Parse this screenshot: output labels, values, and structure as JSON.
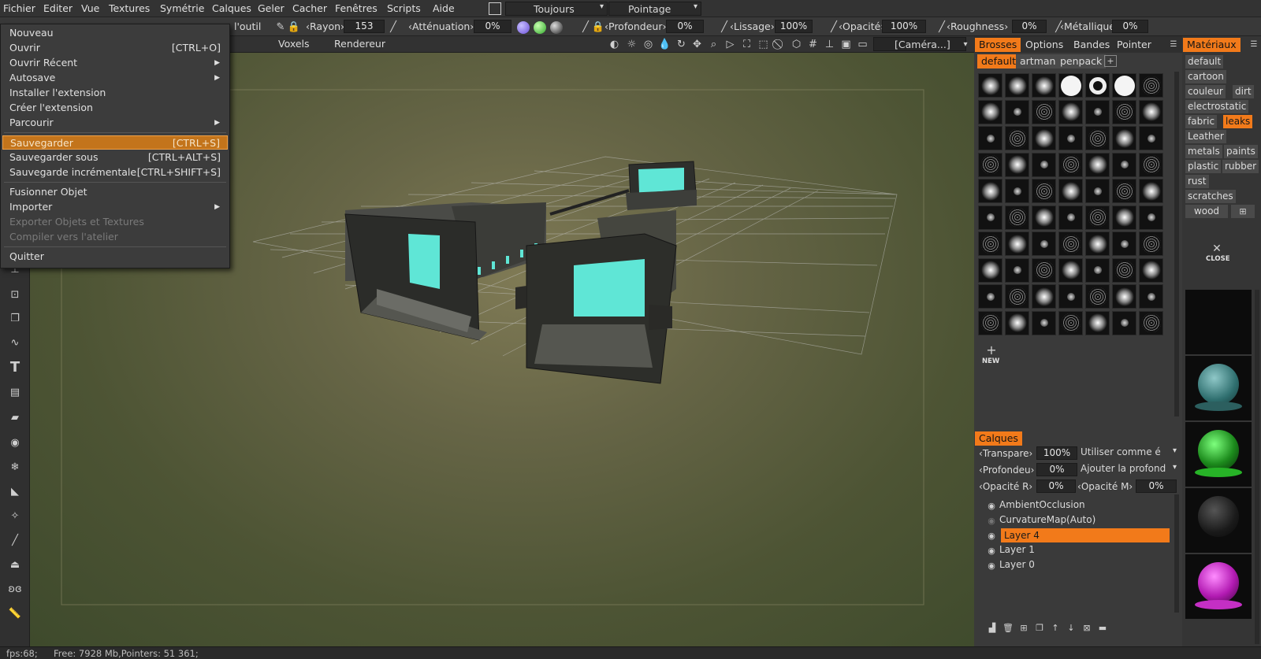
{
  "menubar": {
    "items": [
      "Fichier",
      "Editer",
      "Vue",
      "Textures",
      "Symétrie",
      "Calques",
      "Geler",
      "Cacher",
      "Fenêtres",
      "Scripts",
      "Aide"
    ],
    "mode_select": "Toujours",
    "pointer_select": "Pointage"
  },
  "toolbar": {
    "tool_label": "l'outil",
    "rayon_label": "Rayon",
    "rayon_value": "153",
    "attenuation_label": "Atténuation",
    "attenuation_value": "0%",
    "profondeur_label": "Profondeur",
    "profondeur_value": "0%",
    "lissage_label": "Lissage",
    "lissage_value": "100%",
    "opacite_label": "Opacité",
    "opacite_value": "100%",
    "roughness_label": "Roughness",
    "roughness_value": "0%",
    "metallique_label": "Métallique",
    "metallique_value": "0%"
  },
  "subbar": {
    "voxels_label": "Voxels",
    "renderer_label": "Rendereur",
    "camera_select": "[Caméra...]"
  },
  "file_menu": {
    "items": [
      {
        "label": "Nouveau",
        "shortcut": "",
        "arrow": false,
        "disabled": false
      },
      {
        "label": "Ouvrir",
        "shortcut": "[CTRL+O]",
        "arrow": false,
        "disabled": false
      },
      {
        "label": "Ouvrir Récent",
        "shortcut": "",
        "arrow": true,
        "disabled": false
      },
      {
        "label": "Autosave",
        "shortcut": "",
        "arrow": true,
        "disabled": false
      },
      {
        "label": "Installer l'extension",
        "shortcut": "",
        "arrow": false,
        "disabled": false
      },
      {
        "label": "Créer l'extension",
        "shortcut": "",
        "arrow": false,
        "disabled": false
      },
      {
        "label": "Parcourir",
        "shortcut": "",
        "arrow": true,
        "disabled": false
      },
      {
        "label": "Sauvegarder",
        "shortcut": "[CTRL+S]",
        "arrow": false,
        "disabled": false,
        "selected": true
      },
      {
        "label": "Sauvegarder sous",
        "shortcut": "[CTRL+ALT+S]",
        "arrow": false,
        "disabled": false
      },
      {
        "label": "Sauvegarde incrémentale",
        "shortcut": "[CTRL+SHIFT+S]",
        "arrow": false,
        "disabled": false
      },
      {
        "label": "Fusionner Objet",
        "shortcut": "",
        "arrow": false,
        "disabled": false
      },
      {
        "label": "Importer",
        "shortcut": "",
        "arrow": true,
        "disabled": false
      },
      {
        "label": "Exporter Objets et Textures",
        "shortcut": "",
        "arrow": false,
        "disabled": true
      },
      {
        "label": "Compiler vers l'atelier",
        "shortcut": "",
        "arrow": false,
        "disabled": true
      },
      {
        "label": "Quitter",
        "shortcut": "",
        "arrow": false,
        "disabled": false
      }
    ]
  },
  "brushes_panel": {
    "tabs": [
      "Brosses",
      "Options",
      "Bandes",
      "Pointer"
    ],
    "active_tab": "Brosses",
    "packs": [
      "default",
      "artman",
      "penpack"
    ],
    "active_pack": "default",
    "new_label": "NEW"
  },
  "materials_panel": {
    "title": "Matériaux",
    "tags": [
      "default",
      "cartoon",
      "couleur",
      "dirt",
      "electrostatic",
      "fabric",
      "leaks",
      "Leather",
      "metals",
      "paints",
      "plastic",
      "rubber",
      "rust",
      "scratches",
      "wood"
    ],
    "active_tag": "leaks",
    "close_label": "CLOSE"
  },
  "layers_panel": {
    "title": "Calques",
    "transparence_label": "Transpare",
    "transparence_value": "100%",
    "transparence_mode": "Utiliser comme é",
    "profondeur_label": "Profondeu",
    "profondeur_value": "0%",
    "profondeur_mode": "Ajouter la profond",
    "opacite_r_label": "Opacité R",
    "opacite_r_value": "0%",
    "opacite_m_label": "Opacité M",
    "opacite_m_value": "0%",
    "layers": [
      "AmbientOcclusion",
      "CurvatureMap(Auto)",
      "Layer 4",
      "Layer 1",
      "Layer 0"
    ],
    "active_layer": "Layer 4"
  },
  "status": {
    "fps": "fps:68;",
    "memory": "Free: 7928 Mb,Pointers: 51 361;"
  },
  "colors": {
    "accent": "#f27a1a",
    "menu_selection": "#c3741b",
    "panel_bg": "#3a3a3a",
    "teal": "#5fe6d6"
  }
}
